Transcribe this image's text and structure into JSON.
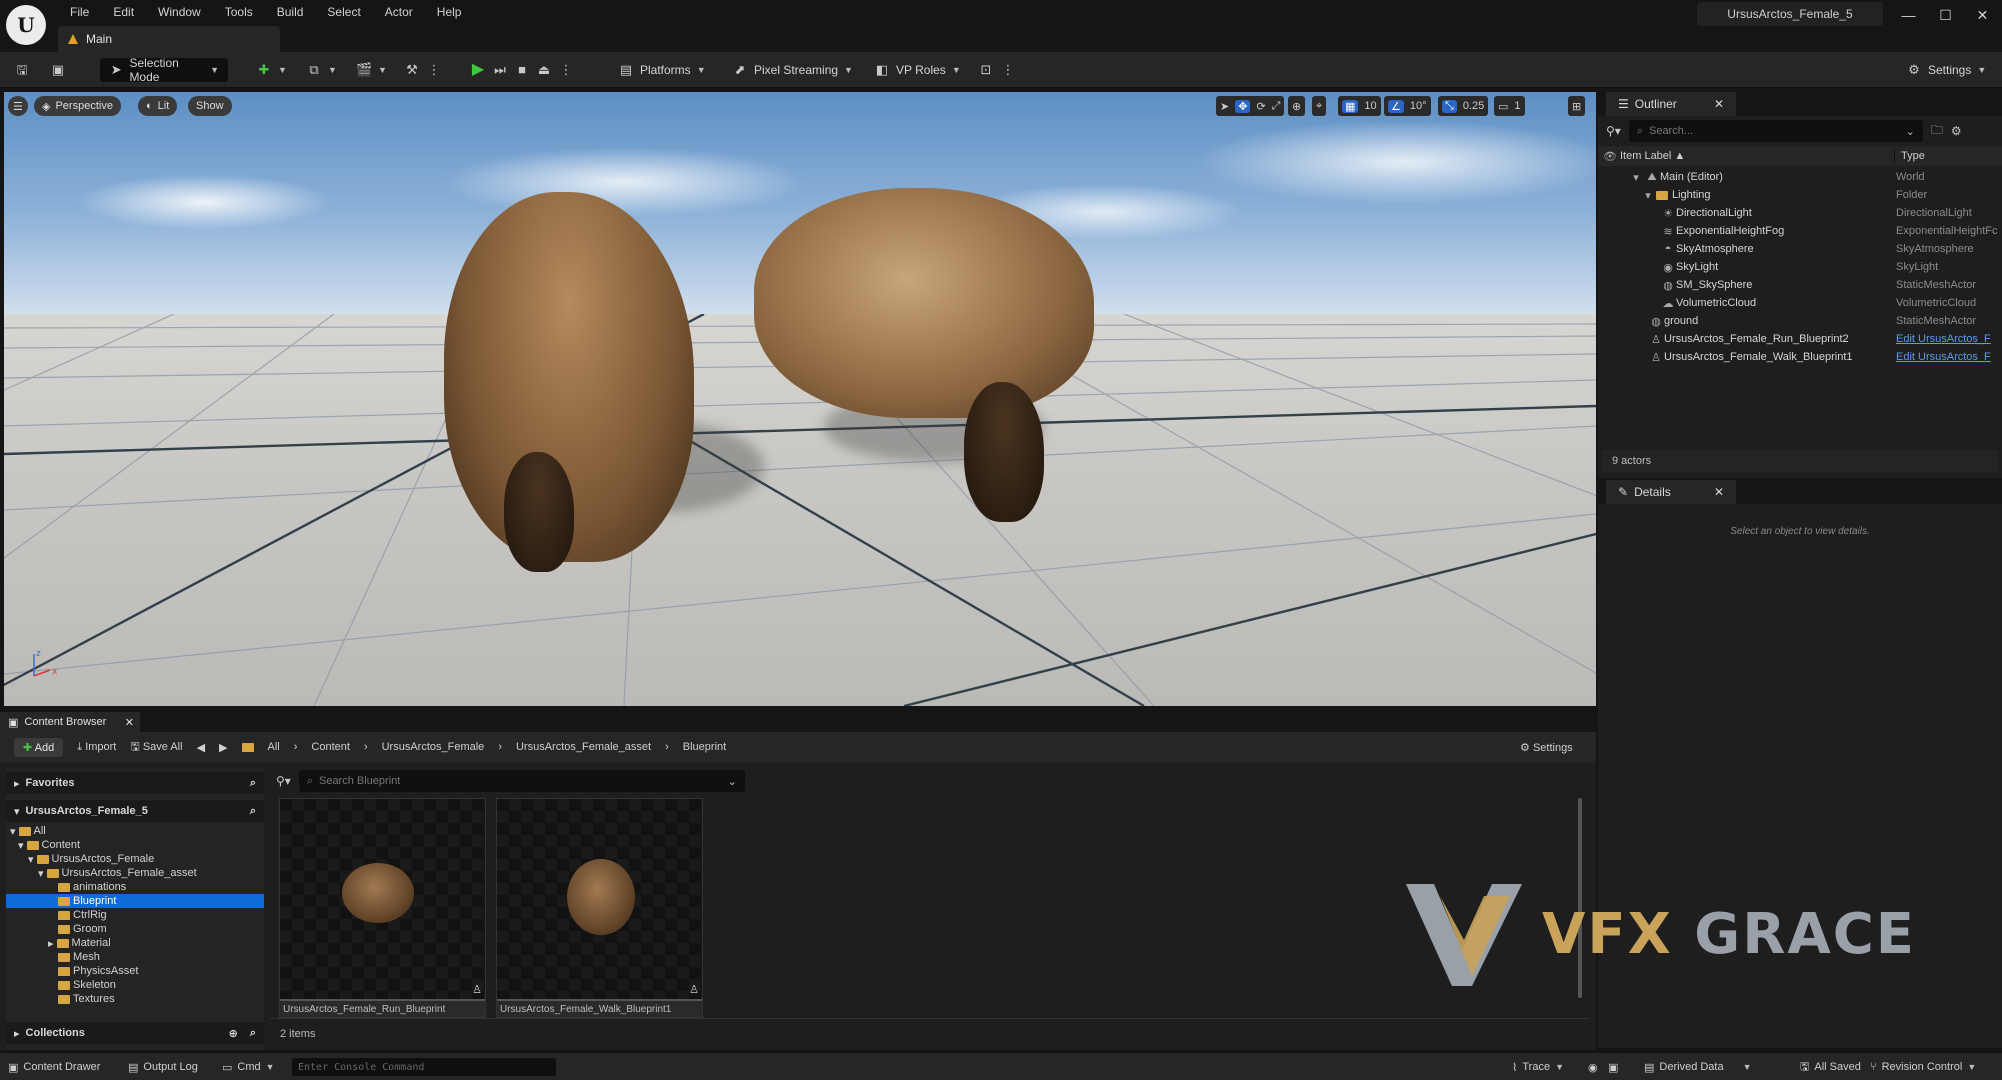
{
  "menu": [
    "File",
    "Edit",
    "Window",
    "Tools",
    "Build",
    "Select",
    "Actor",
    "Help"
  ],
  "level_tab": "Main",
  "project_name": "UrsusArctos_Female_5",
  "window_controls": [
    "—",
    "☐",
    "✕"
  ],
  "toolbar": {
    "selection_mode": "Selection Mode",
    "platforms": "Platforms",
    "pixel_streaming": "Pixel Streaming",
    "vp_roles": "VP Roles",
    "settings": "Settings"
  },
  "viewport": {
    "perspective": "Perspective",
    "lit": "Lit",
    "show": "Show",
    "grid_snap": "10",
    "rotation_snap": "10°",
    "scale_snap": "0.25",
    "camera_speed": "1"
  },
  "outliner": {
    "title": "Outliner",
    "search_placeholder": "Search...",
    "col_label": "Item Label ▲",
    "col_type": "Type",
    "rows": [
      {
        "label": "Main (Editor)",
        "type": "World"
      },
      {
        "label": "Lighting",
        "type": "Folder"
      },
      {
        "label": "DirectionalLight",
        "type": "DirectionalLight"
      },
      {
        "label": "ExponentialHeightFog",
        "type": "ExponentialHeightFc"
      },
      {
        "label": "SkyAtmosphere",
        "type": "SkyAtmosphere"
      },
      {
        "label": "SkyLight",
        "type": "SkyLight"
      },
      {
        "label": "SM_SkySphere",
        "type": "StaticMeshActor"
      },
      {
        "label": "VolumetricCloud",
        "type": "VolumetricCloud"
      },
      {
        "label": "ground",
        "type": "StaticMeshActor"
      },
      {
        "label": "UrsusArctos_Female_Run_Blueprint2",
        "type": "Edit UrsusArctos_F"
      },
      {
        "label": "UrsusArctos_Female_Walk_Blueprint1",
        "type": "Edit UrsusArctos_F"
      }
    ],
    "count": "9 actors"
  },
  "details": {
    "title": "Details",
    "empty_text": "Select an object to view details."
  },
  "content_browser": {
    "title": "Content Browser",
    "add": "Add",
    "import": "Import",
    "save_all": "Save All",
    "breadcrumb": [
      "All",
      "Content",
      "UrsusArctos_Female",
      "UrsusArctos_Female_asset",
      "Blueprint"
    ],
    "settings": "Settings",
    "favorites": "Favorites",
    "project": "UrsusArctos_Female_5",
    "collections": "Collections",
    "search_placeholder": "Search Blueprint",
    "tree": [
      "All",
      "Content",
      "UrsusArctos_Female",
      "UrsusArctos_Female_asset",
      "animations",
      "Blueprint",
      "CtrlRig",
      "Groom",
      "Material",
      "Mesh",
      "PhysicsAsset",
      "Skeleton",
      "Textures"
    ],
    "assets": [
      "UrsusArctos_Female_Run_Blueprint",
      "UrsusArctos_Female_Walk_Blueprint1"
    ],
    "item_count": "2 items"
  },
  "watermark": {
    "part1": "VFX",
    "part2": "GRACE"
  },
  "statusbar": {
    "content_drawer": "Content Drawer",
    "output_log": "Output Log",
    "cmd": "Cmd",
    "console_placeholder": "Enter Console Command",
    "trace": "Trace",
    "derived_data": "Derived Data",
    "all_saved": "All Saved",
    "revision_control": "Revision Control"
  },
  "colors": {
    "accent": "#0a6cd4",
    "play": "#3fc93f",
    "folder": "#d8a640"
  }
}
